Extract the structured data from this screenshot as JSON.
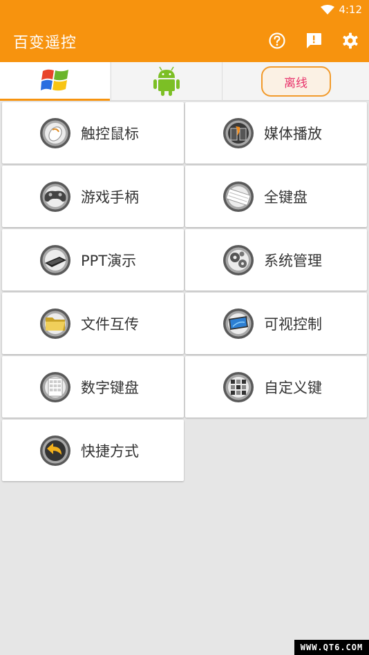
{
  "status_bar": {
    "time": "4:12",
    "wifi_icon": "wifi-icon"
  },
  "app_bar": {
    "title": "百变遥控",
    "actions": [
      "help-icon",
      "feedback-icon",
      "settings-icon"
    ]
  },
  "tabs": {
    "windows_icon": "windows-logo-icon",
    "android_icon": "android-robot-icon",
    "offline_label": "离线",
    "active_tab": "windows"
  },
  "colors": {
    "primary": "#f7930e",
    "offline_text": "#e8336b",
    "background": "#e6e6e6"
  },
  "menu": {
    "items": [
      {
        "label": "触控鼠标",
        "icon": "mouse-icon"
      },
      {
        "label": "媒体播放",
        "icon": "media-player-icon"
      },
      {
        "label": "游戏手柄",
        "icon": "gamepad-icon"
      },
      {
        "label": "全键盘",
        "icon": "keyboard-icon"
      },
      {
        "label": "PPT演示",
        "icon": "presentation-icon"
      },
      {
        "label": "系统管理",
        "icon": "system-gears-icon"
      },
      {
        "label": "文件互传",
        "icon": "folder-icon"
      },
      {
        "label": "可视控制",
        "icon": "monitor-icon"
      },
      {
        "label": "数字键盘",
        "icon": "numpad-icon"
      },
      {
        "label": "自定义键",
        "icon": "custom-keys-icon"
      },
      {
        "label": "快捷方式",
        "icon": "shortcut-arrow-icon"
      }
    ]
  },
  "watermark": "WWW.QT6.COM"
}
